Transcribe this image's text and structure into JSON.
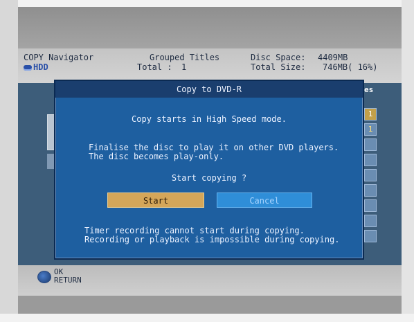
{
  "header": {
    "navigator_title": "COPY Navigator",
    "source": "HDD",
    "group_label": "Grouped Titles",
    "total_label": "Total :",
    "total_value": "1",
    "disc_space_label": "Disc Space:",
    "disc_space_value": "4409MB",
    "total_size_label": "Total Size:",
    "total_size_value": "746MB( 16%)"
  },
  "list": {
    "column_header": "es",
    "side_cells": [
      "1",
      "1",
      "",
      "",
      "",
      "",
      "",
      "",
      "",
      ""
    ]
  },
  "dialog": {
    "title": "Copy to DVD-R",
    "line1": "Copy starts in High Speed mode.",
    "line2": "Finalise the disc to play it on other DVD players.",
    "line3": "The disc becomes play-only.",
    "prompt": "Start copying ?",
    "start_label": "Start",
    "cancel_label": "Cancel",
    "note1": "Timer recording cannot start during copying.",
    "note2": "Recording or playback is impossible during copying."
  },
  "footer": {
    "ok_label": "OK",
    "return_label": "RETURN"
  },
  "colors": {
    "dialog_bg": "#1e5fa0",
    "start_button": "#d4a659",
    "cancel_button": "#2f8ed8",
    "accent": "#2a50a8"
  }
}
